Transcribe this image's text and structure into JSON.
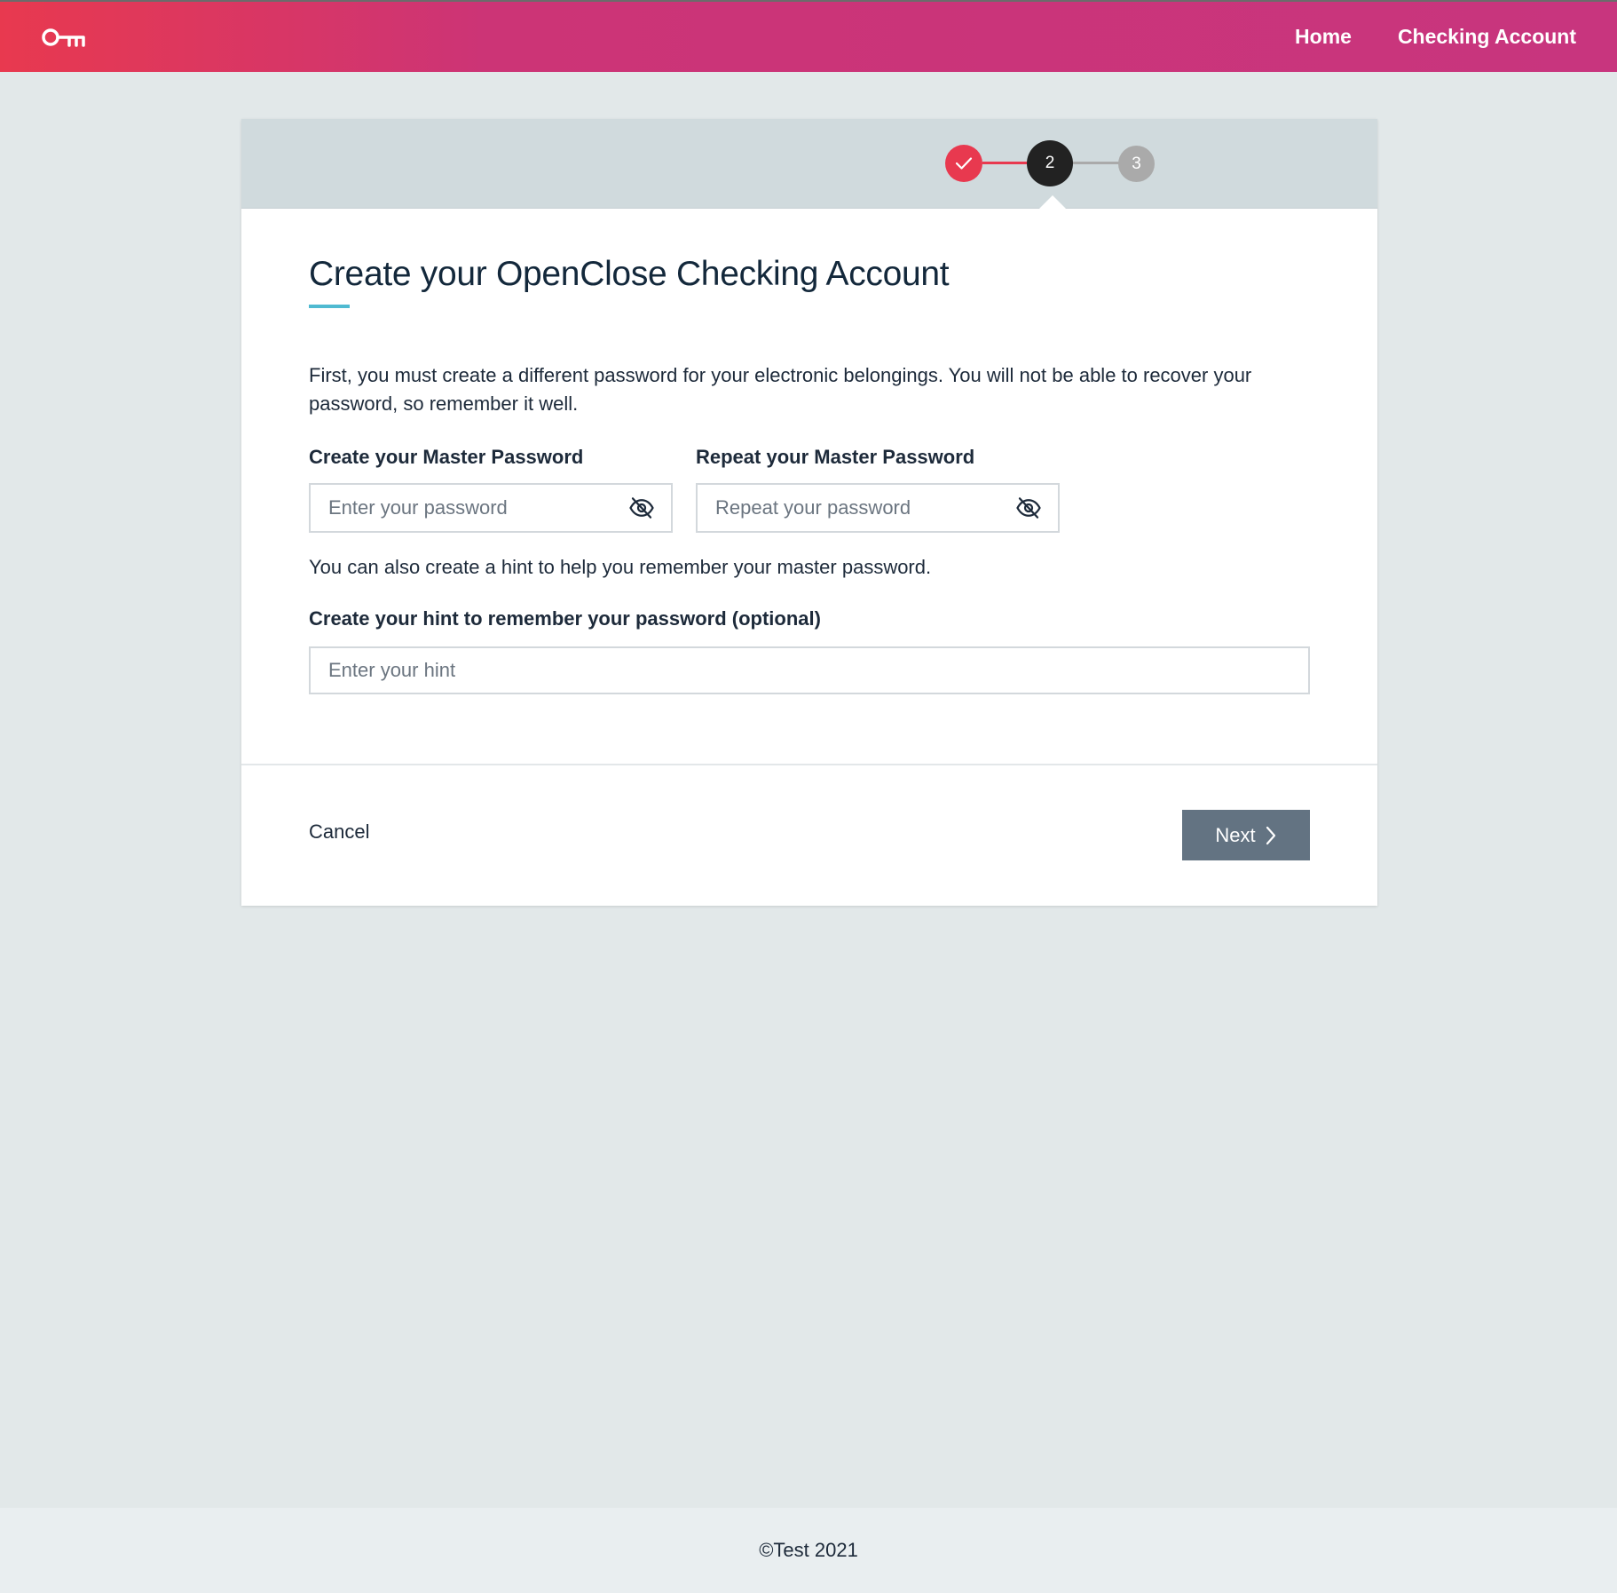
{
  "header": {
    "logo_icon": "key-icon",
    "nav": [
      {
        "label": "Home"
      },
      {
        "label": "Checking Account"
      }
    ],
    "colors": {
      "gradient_start": "#e8394f",
      "gradient_end": "#c8357e"
    }
  },
  "stepper": {
    "steps": [
      {
        "label": "",
        "state": "completed",
        "icon": "check-icon"
      },
      {
        "label": "2",
        "state": "current"
      },
      {
        "label": "3",
        "state": "upcoming"
      }
    ],
    "colors": {
      "completed": "#e8394f",
      "current": "#222222",
      "upcoming": "#aaaaaa"
    }
  },
  "form": {
    "title": "Create your OpenClose Checking Account",
    "intro": "First, you must create a different password for your electronic belongings. You will not be able to recover your password, so remember it well.",
    "password": {
      "label": "Create your Master Password",
      "placeholder": "Enter your password",
      "value": "",
      "icon": "eye-off-icon"
    },
    "repeat_password": {
      "label": "Repeat your Master Password",
      "placeholder": "Repeat your password",
      "value": "",
      "icon": "eye-off-icon"
    },
    "hint_text": "You can also create a hint to help you remember your master password.",
    "hint": {
      "label": "Create your hint to remember your password (optional)",
      "placeholder": "Enter your hint",
      "value": ""
    }
  },
  "actions": {
    "cancel_label": "Cancel",
    "next_label": "Next",
    "next_icon": "chevron-right-icon",
    "next_color": "#637382"
  },
  "footer": {
    "text": "©Test 2021"
  }
}
